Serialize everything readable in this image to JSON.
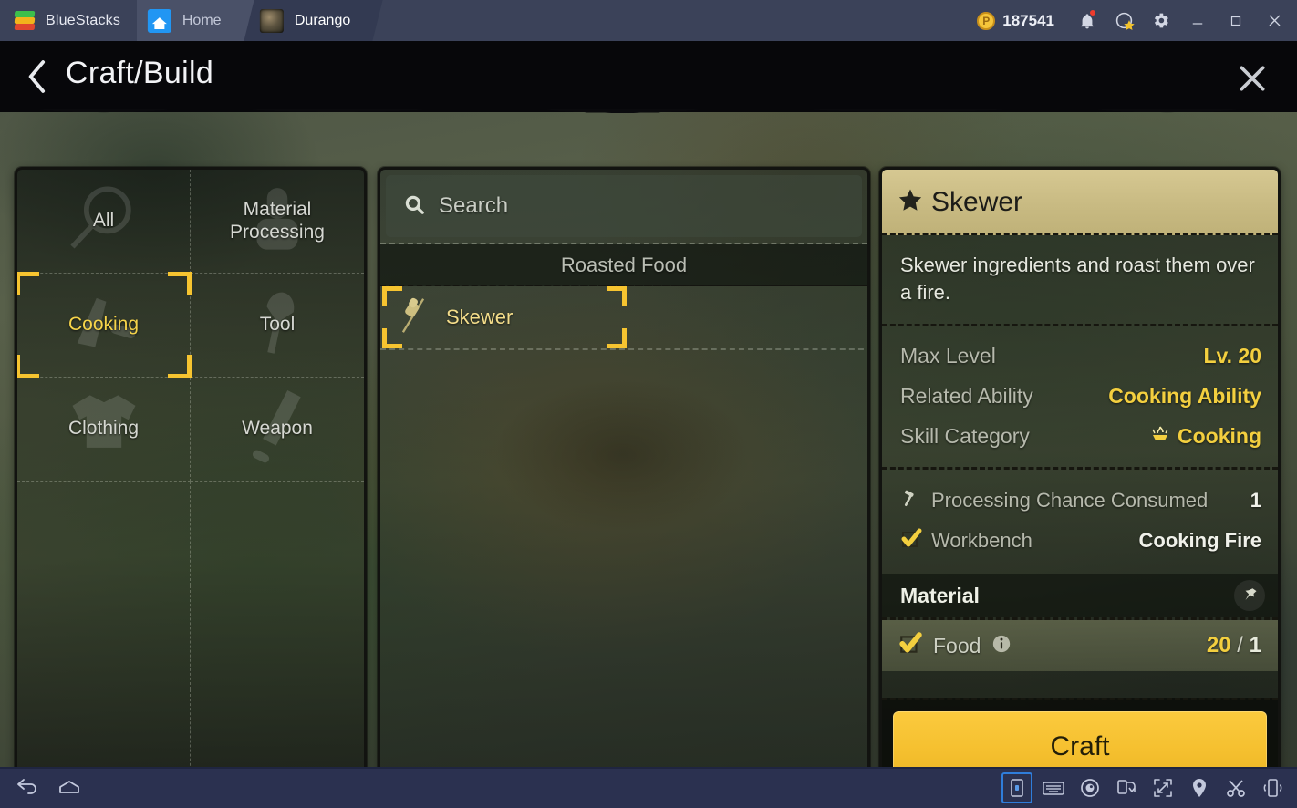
{
  "titlebar": {
    "brand": "BlueStacks",
    "tabs": [
      {
        "label": "Home",
        "icon": "home-icon"
      },
      {
        "label": "Durango",
        "icon": "durango-game-icon"
      }
    ],
    "points": "187541",
    "coin_symbol": "P",
    "icons": {
      "notification": "bell-icon",
      "account": "account-star-icon",
      "settings": "gear-icon",
      "minimize": "minimize-icon",
      "maximize": "maximize-icon",
      "close": "close-icon"
    }
  },
  "header": {
    "back_icon": "chevron-left-icon",
    "title": "Craft/Build",
    "close_icon": "close-icon"
  },
  "categories": [
    {
      "label": "All",
      "icon": "magnifier-icon",
      "selected": false
    },
    {
      "label": "Material\nProcessing",
      "icon": "mortar-icon",
      "selected": false
    },
    {
      "label": "Cooking",
      "icon": "knife-icon",
      "selected": true
    },
    {
      "label": "Tool",
      "icon": "shovel-icon",
      "selected": false
    },
    {
      "label": "Clothing",
      "icon": "shirt-icon",
      "selected": false
    },
    {
      "label": "Weapon",
      "icon": "sword-icon",
      "selected": false
    },
    {
      "label": "",
      "icon": "",
      "selected": false
    },
    {
      "label": "",
      "icon": "",
      "selected": false
    },
    {
      "label": "",
      "icon": "",
      "selected": false
    },
    {
      "label": "",
      "icon": "",
      "selected": false
    },
    {
      "label": "",
      "icon": "",
      "selected": false
    },
    {
      "label": "",
      "icon": "",
      "selected": false
    }
  ],
  "list": {
    "search_placeholder": "Search",
    "search_value": "",
    "search_icon": "search-icon",
    "group_label": "Roasted Food",
    "recipes": [
      {
        "name": "Skewer",
        "icon": "skewer-icon",
        "selected": true
      }
    ]
  },
  "detail": {
    "star_icon": "star-icon",
    "name": "Skewer",
    "description": "Skewer ingredients and roast them over a fire.",
    "stats": [
      {
        "key": "Max Level",
        "value": "Lv. 20",
        "icon": ""
      },
      {
        "key": "Related Ability",
        "value": "Cooking Ability",
        "icon": ""
      },
      {
        "key": "Skill Category",
        "value": "Cooking",
        "icon": "campfire-icon"
      }
    ],
    "requirements": [
      {
        "icon": "hammer-icon",
        "name": "Processing Chance Consumed",
        "value": "1"
      },
      {
        "icon": "check-icon",
        "name": "Workbench",
        "value": "Cooking Fire"
      }
    ],
    "material_header": "Material",
    "pin_icon": "pin-icon",
    "materials": [
      {
        "check_icon": "check-icon",
        "name": "Food",
        "info_icon": "info-icon",
        "have": "20",
        "separator": "/",
        "need": "1"
      }
    ],
    "craft_label": "Craft"
  },
  "bottombar": {
    "left": [
      {
        "icon": "back-arrow-icon"
      },
      {
        "icon": "home-outline-icon"
      }
    ],
    "right": [
      {
        "icon": "multi-instance-icon",
        "active": true
      },
      {
        "icon": "keyboard-icon",
        "active": false
      },
      {
        "icon": "record-icon",
        "active": false
      },
      {
        "icon": "rotate-icon",
        "active": false
      },
      {
        "icon": "fullscreen-icon",
        "active": false
      },
      {
        "icon": "location-pin-icon",
        "active": false
      },
      {
        "icon": "scissors-icon",
        "active": false
      },
      {
        "icon": "shake-icon",
        "active": false
      }
    ]
  },
  "colors": {
    "accent_yellow": "#f3cf3f",
    "craft_button": "#f5c02f",
    "titlebar_bg": "#3b4259",
    "bottombar_bg": "#2b3150",
    "header_bg": "#07070a",
    "detail_title_bg": "#c8ba82"
  }
}
